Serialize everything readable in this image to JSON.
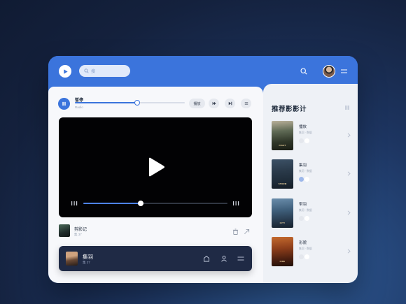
{
  "header": {
    "search_placeholder": "搜"
  },
  "player": {
    "title": "暂停",
    "subtitle": "Radio",
    "progress": 0.57,
    "buttons": {
      "play_label": "播放"
    }
  },
  "video": {
    "progress": 0.4
  },
  "now_playing": {
    "title": "剪影记",
    "subtitle": "集 37"
  },
  "dock": {
    "title": "集羽",
    "subtitle": "集 37"
  },
  "sidebar": {
    "title": "推荐影影计",
    "items": [
      {
        "title": "播放",
        "meta": "集羽 · 数据"
      },
      {
        "title": "集羽",
        "meta": "集羽 · 数据"
      },
      {
        "title": "带羽",
        "meta": "集羽 · 数据"
      },
      {
        "title": "形貌",
        "meta": "集羽 · 数据"
      }
    ]
  },
  "colors": {
    "accent": "#3b74dc",
    "dock": "#1f2a45",
    "video_bg": "#020204"
  },
  "icons": [
    "play-logo-icon",
    "search-icon",
    "menu-icon",
    "pause-icon",
    "next-icon",
    "skip-icon",
    "list-icon",
    "play-icon",
    "trash-icon",
    "arrow-icon",
    "home-icon",
    "user-icon",
    "chevron-right-icon"
  ]
}
